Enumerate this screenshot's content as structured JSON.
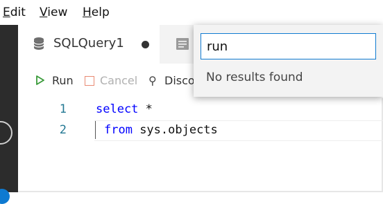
{
  "menu": {
    "items": [
      {
        "accel": "E",
        "rest": "dit"
      },
      {
        "accel": "V",
        "rest": "iew"
      },
      {
        "accel": "H",
        "rest": "elp"
      }
    ]
  },
  "tabs": [
    {
      "label": "SQLQuery1",
      "dirty": true
    }
  ],
  "toolbar": {
    "run_label": "Run",
    "cancel_label": "Cancel",
    "disconnect_label": "Disco"
  },
  "editor": {
    "lines": [
      {
        "number": "1",
        "keyword": "select",
        "rest": " *"
      },
      {
        "number": "2",
        "keyword": "from",
        "rest": " sys.objects"
      }
    ]
  },
  "quick_open": {
    "query": "run",
    "message": "No results found"
  },
  "colors": {
    "accent": "#0e7ad1",
    "keyword": "#0000ff",
    "line_number": "#237893",
    "run_icon": "#3a9b3a",
    "cancel_icon": "#e98a73"
  }
}
